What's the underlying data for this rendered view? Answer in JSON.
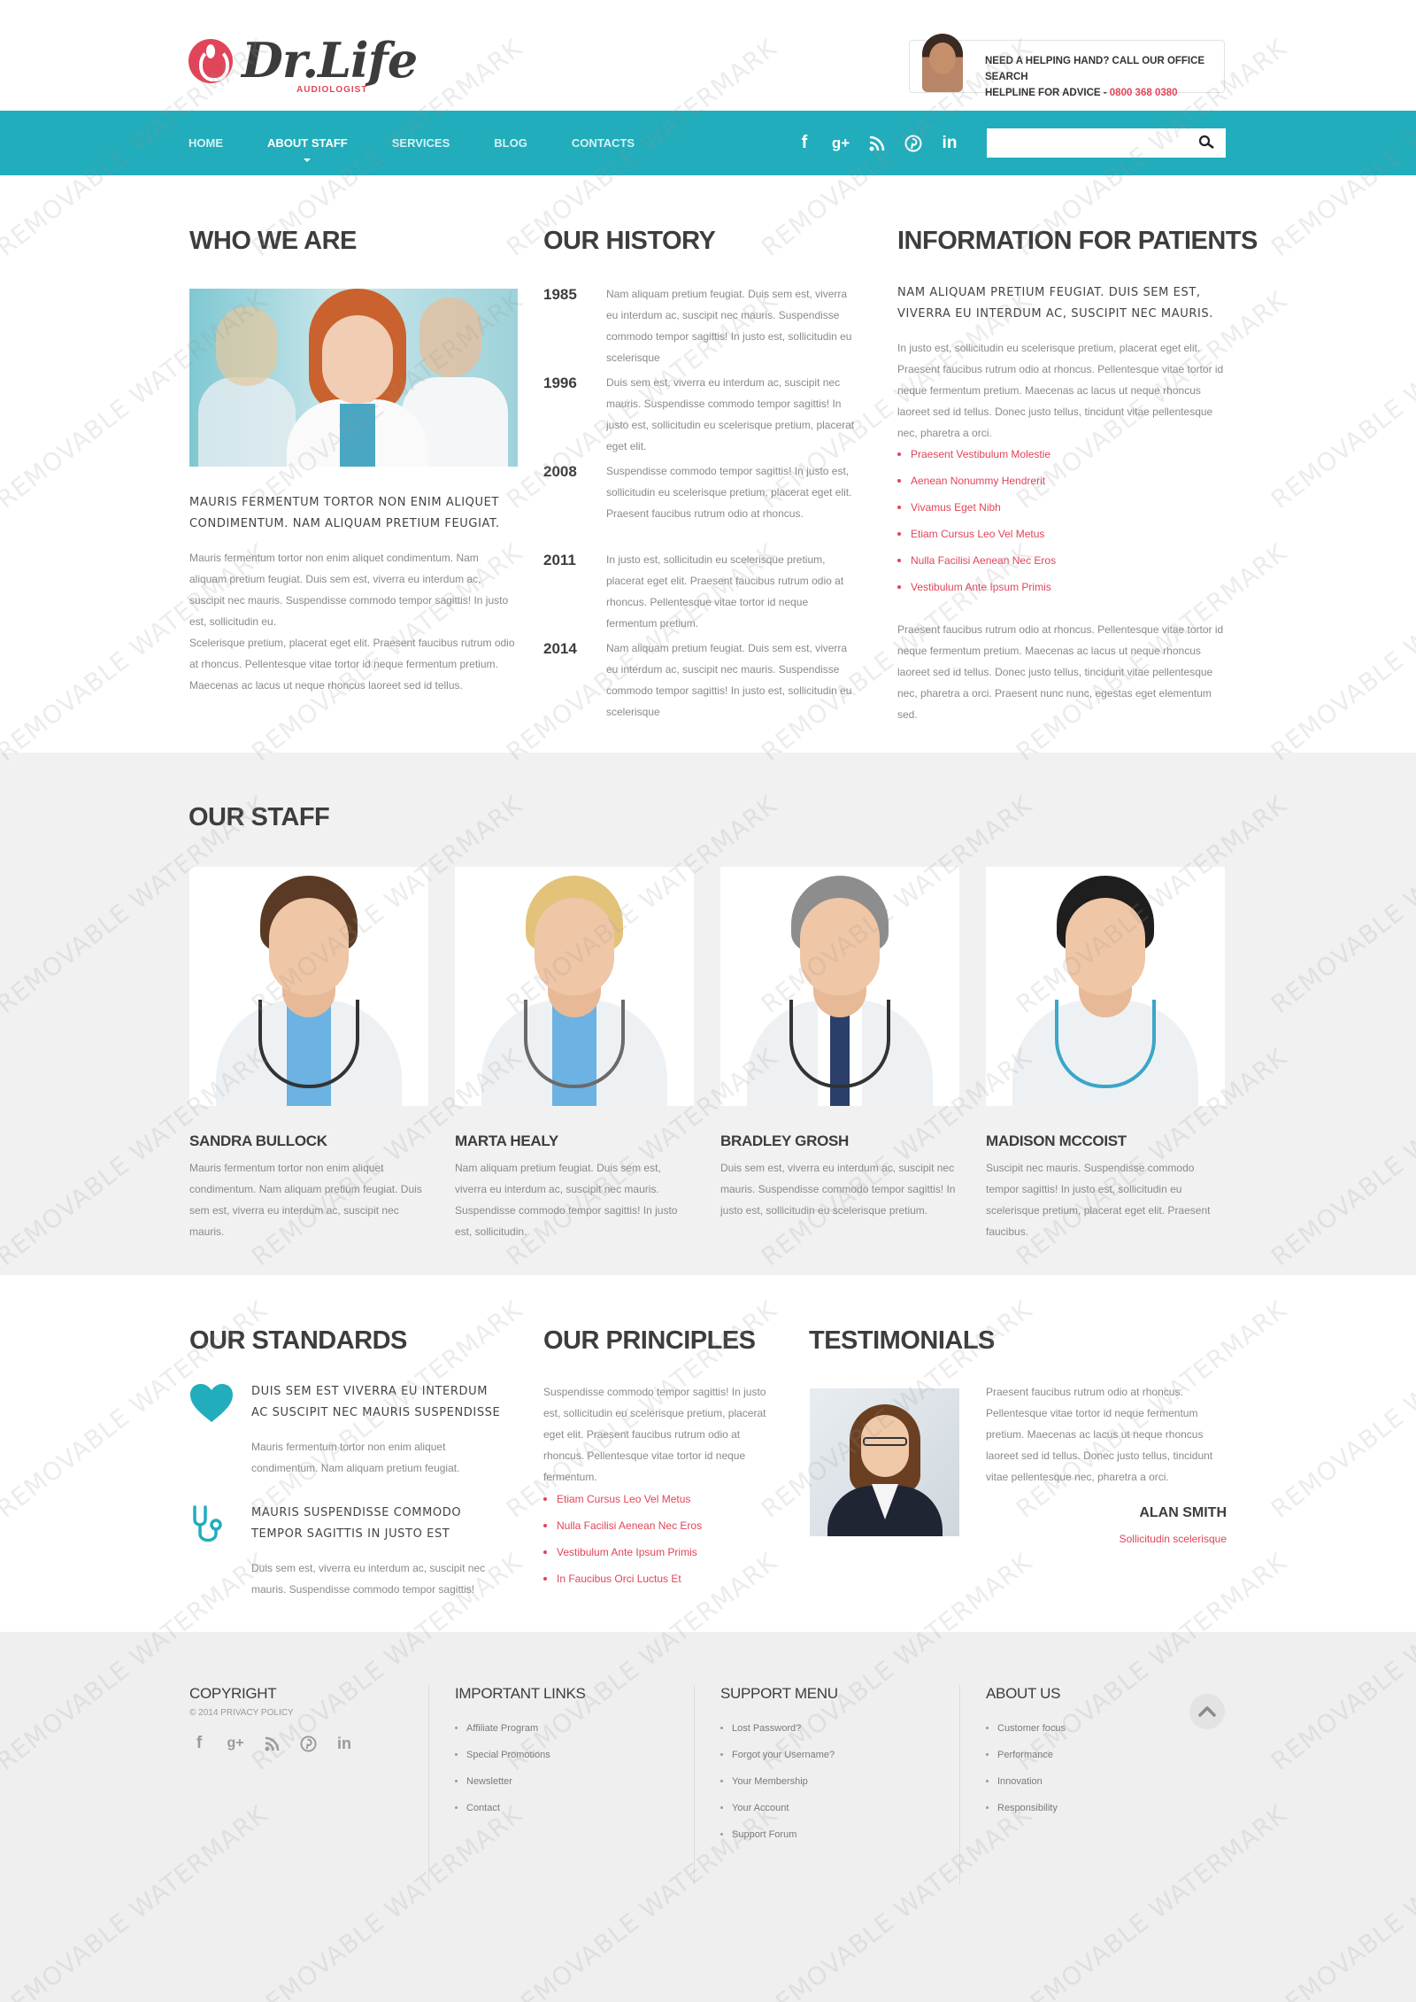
{
  "brand": {
    "name": "Dr.Life",
    "tagline": "AUDIOLOGIST",
    "accent": "#e0455a",
    "teal": "#21adbb"
  },
  "help": {
    "line1": "NEED A HELPING HAND? CALL OUR OFFICE SEARCH",
    "line2": "HELPLINE FOR ADVICE - ",
    "phone": "0800 368 0380"
  },
  "nav": {
    "items": [
      {
        "label": "HOME"
      },
      {
        "label": "ABOUT STAFF"
      },
      {
        "label": "SERVICES"
      },
      {
        "label": "BLOG"
      },
      {
        "label": "CONTACTS"
      }
    ],
    "active": "ABOUT STAFF",
    "social": [
      "facebook-icon",
      "google-plus-icon",
      "rss-icon",
      "pinterest-icon",
      "linkedin-icon"
    ],
    "search_placeholder": ""
  },
  "who": {
    "title": "WHO WE ARE",
    "lead": "MAURIS FERMENTUM TORTOR NON ENIM ALIQUET CONDIMENTUM. NAM ALIQUAM PRETIUM FEUGIAT.",
    "p1": "Mauris fermentum tortor non enim aliquet condimentum. Nam aliquam pretium feugiat. Duis sem est, viverra eu interdum ac, suscipit nec mauris. Suspendisse commodo tempor sagittis! In justo est, sollicitudin eu.",
    "p2": "Scelerisque pretium, placerat eget elit. Praesent faucibus rutrum odio at rhoncus. Pellentesque vitae tortor id neque fermentum pretium. Maecenas ac lacus ut neque rhoncus laoreet sed id tellus."
  },
  "history": {
    "title": "OUR HISTORY",
    "entries": [
      {
        "year": "1985",
        "text": "Nam aliquam pretium feugiat. Duis sem est, viverra eu interdum ac, suscipit nec mauris. Suspendisse commodo tempor sagittis! In justo est, sollicitudin eu scelerisque"
      },
      {
        "year": "1996",
        "text": "Duis sem est, viverra eu interdum ac, suscipit nec mauris. Suspendisse commodo tempor sagittis! In justo est, sollicitudin eu scelerisque pretium, placerat eget elit."
      },
      {
        "year": "2008",
        "text": "Suspendisse commodo tempor sagittis! In justo est, sollicitudin eu scelerisque pretium, placerat eget elit. Praesent faucibus rutrum odio at rhoncus."
      },
      {
        "year": "2011",
        "text": "In justo est, sollicitudin eu scelerisque pretium, placerat eget elit. Praesent faucibus rutrum odio at rhoncus. Pellentesque vitae tortor id neque fermentum pretium."
      },
      {
        "year": "2014",
        "text": "Nam aliquam pretium feugiat. Duis sem est, viverra eu interdum ac, suscipit nec mauris. Suspendisse commodo tempor sagittis! In justo est, sollicitudin eu scelerisque"
      }
    ]
  },
  "patients": {
    "title": "INFORMATION FOR PATIENTS",
    "lead": "NAM ALIQUAM PRETIUM FEUGIAT. DUIS SEM EST, VIVERRA EU INTERDUM AC, SUSCIPIT NEC MAURIS.",
    "p1": "In justo est, sollicitudin eu scelerisque pretium, placerat eget elit. Praesent faucibus rutrum odio at rhoncus. Pellentesque vitae tortor id neque fermentum pretium. Maecenas ac lacus ut neque rhoncus laoreet sed id tellus. Donec justo tellus, tincidunt vitae pellentesque nec, pharetra a orci.",
    "links": [
      "Praesent Vestibulum Molestie",
      "Aenean Nonummy Hendrerit",
      "Vivamus Eget Nibh",
      "Etiam Cursus Leo Vel Metus",
      "Nulla Facilisi Aenean Nec Eros",
      "Vestibulum Ante Ipsum Primis"
    ],
    "p2": "Praesent faucibus rutrum odio at rhoncus. Pellentesque vitae tortor id neque fermentum pretium. Maecenas ac lacus ut neque rhoncus laoreet sed id tellus. Donec justo tellus, tincidunt vitae pellentesque nec, pharetra a orci. Praesent nunc nunc, egestas eget elementum sed."
  },
  "staff": {
    "title": "OUR STAFF",
    "members": [
      {
        "name": "SANDRA BULLOCK",
        "text": "Mauris fermentum tortor non enim aliquet condimentum. Nam aliquam pretium feugiat. Duis sem est, viverra eu interdum ac, suscipit nec mauris.",
        "hair": "#5a3a24",
        "garment": "scrub"
      },
      {
        "name": "MARTA HEALY",
        "text": "Nam aliquam pretium feugiat. Duis sem est, viverra eu interdum ac, suscipit nec mauris. Suspendisse commodo tempor sagittis! In justo est, sollicitudin.",
        "hair": "#e3c27a",
        "garment": "scrub"
      },
      {
        "name": "BRADLEY GROSH",
        "text": "Duis sem est, viverra eu interdum ac, suscipit nec mauris. Suspendisse commodo tempor sagittis! In justo est, sollicitudin eu scelerisque pretium.",
        "hair": "#8d8d8d",
        "garment": "tie"
      },
      {
        "name": "MADISON MCCOIST",
        "text": "Suscipit nec mauris. Suspendisse commodo tempor sagittis! In justo est, sollicitudin eu scelerisque pretium, placerat eget elit. Praesent faucibus.",
        "hair": "#1e1e1e",
        "garment": "none"
      }
    ]
  },
  "standards": {
    "title": "OUR STANDARDS",
    "items": [
      {
        "icon": "heart-icon",
        "title": "DUIS SEM EST VIVERRA EU INTERDUM AC SUSCIPIT NEC MAURIS SUSPENDISSE",
        "text": "Mauris fermentum tortor non enim aliquet condimentum. Nam aliquam pretium feugiat."
      },
      {
        "icon": "stethoscope-icon",
        "title": "MAURIS SUSPENDISSE COMMODO TEMPOR SAGITTIS IN JUSTO EST",
        "text": "Duis sem est, viverra eu interdum ac, suscipit nec mauris. Suspendisse commodo tempor sagittis!"
      }
    ]
  },
  "principles": {
    "title": "OUR PRINCIPLES",
    "text": "Suspendisse commodo tempor sagittis! In justo est, sollicitudin eu scelerisque pretium, placerat eget elit. Praesent faucibus rutrum odio at rhoncus. Pellentesque vitae tortor id neque fermentum.",
    "links": [
      "Etiam Cursus Leo Vel Metus",
      "Nulla Facilisi Aenean Nec Eros",
      "Vestibulum Ante Ipsum Primis",
      "In Faucibus Orci Luctus Et"
    ]
  },
  "testimonials": {
    "title": "TESTIMONIALS",
    "quote": "Praesent faucibus rutrum odio at rhoncus. Pellentesque vitae tortor id neque fermentum pretium. Maecenas ac lacus ut neque rhoncus laoreet sed id tellus. Donec justo tellus, tincidunt vitae pellentesque nec, pharetra a orci.",
    "author": "ALAN SMITH",
    "role": "Sollicitudin scelerisque"
  },
  "footer": {
    "copyright": {
      "title": "COPYRIGHT",
      "text": "© 2014 PRIVACY POLICY"
    },
    "important": {
      "title": "IMPORTANT LINKS",
      "items": [
        "Affiliate Program",
        "Special Promotions",
        "Newsletter",
        "Contact"
      ]
    },
    "support": {
      "title": "SUPPORT MENU",
      "items": [
        "Lost Password?",
        "Forgot your Username?",
        "Your Membership",
        "Your Account",
        "Support Forum"
      ]
    },
    "about": {
      "title": "ABOUT US",
      "items": [
        "Customer focus",
        "Performance",
        "Innovation",
        "Responsibility"
      ]
    }
  },
  "watermark": "REMOVABLE WATERMARK"
}
